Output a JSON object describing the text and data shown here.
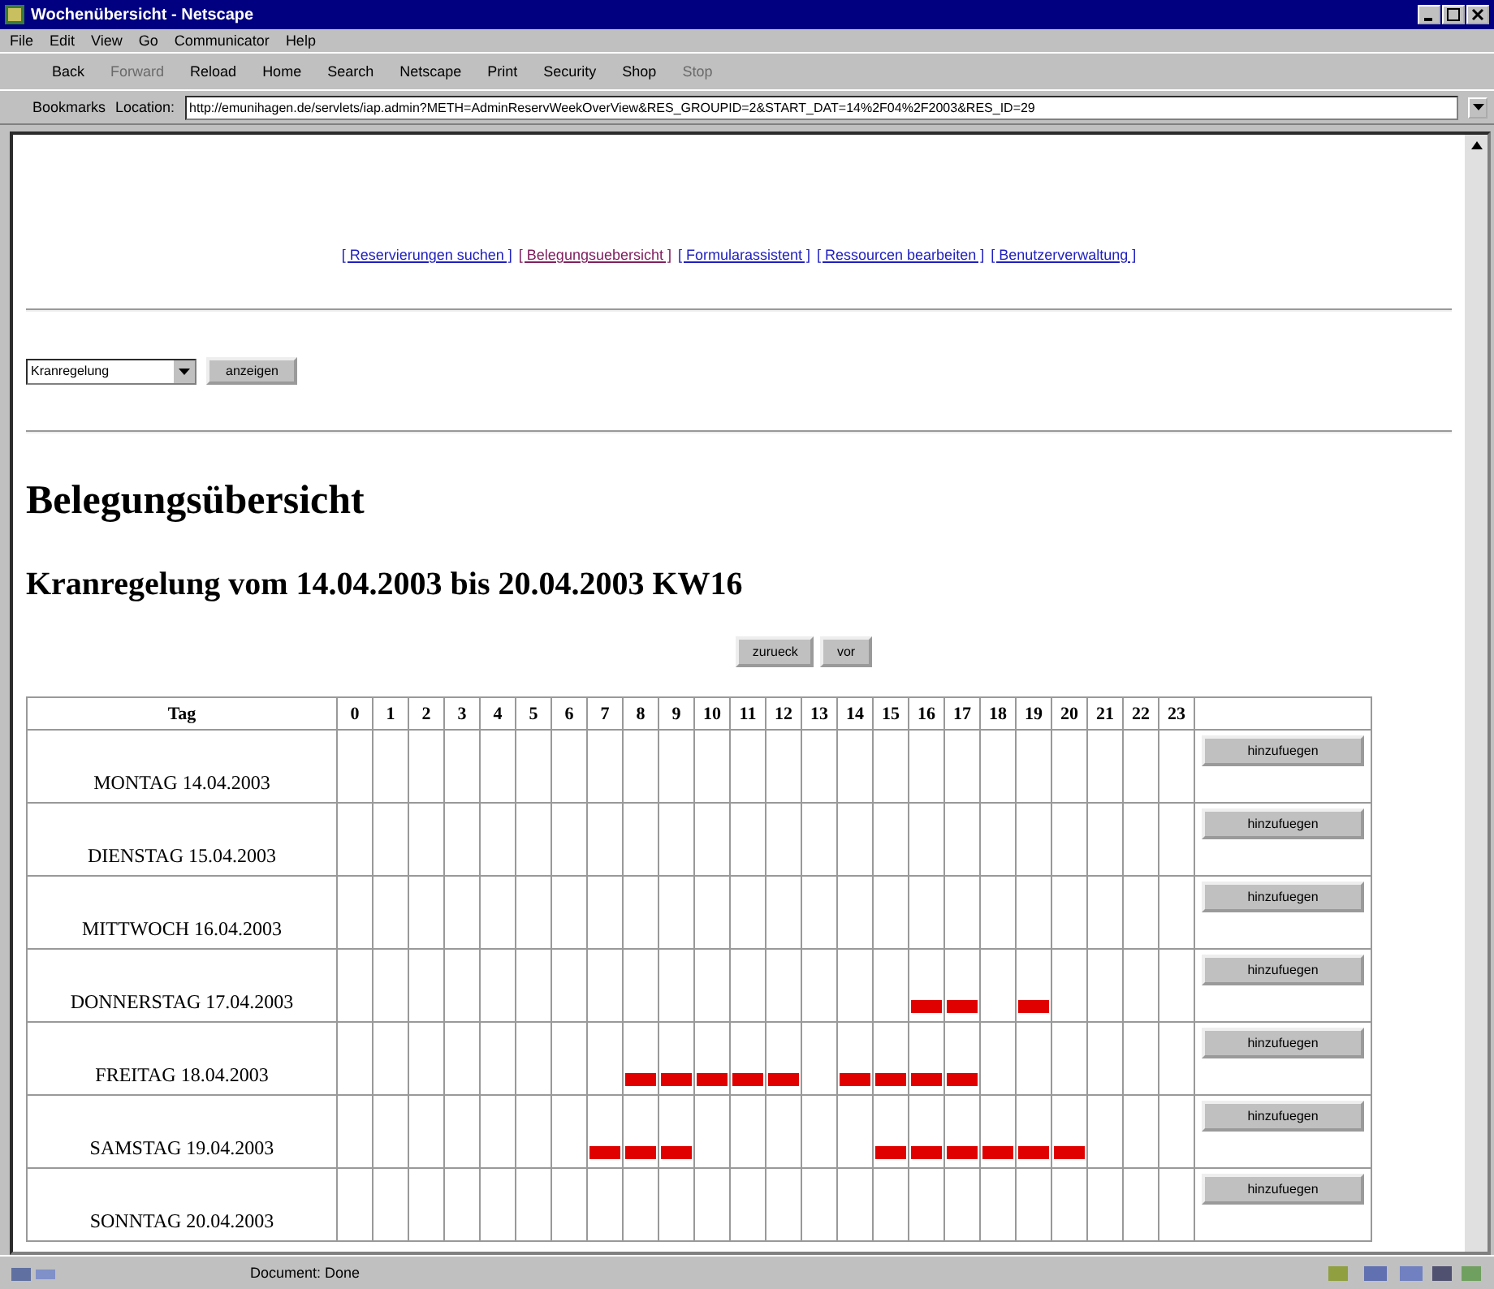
{
  "window": {
    "title": "Wochenübersicht - Netscape"
  },
  "menu": [
    "File",
    "Edit",
    "View",
    "Go",
    "Communicator",
    "Help"
  ],
  "toolbar": [
    {
      "label": "Back",
      "disabled": false
    },
    {
      "label": "Forward",
      "disabled": true
    },
    {
      "label": "Reload",
      "disabled": false
    },
    {
      "label": "Home",
      "disabled": false
    },
    {
      "label": "Search",
      "disabled": false
    },
    {
      "label": "Netscape",
      "disabled": false
    },
    {
      "label": "Print",
      "disabled": false
    },
    {
      "label": "Security",
      "disabled": false
    },
    {
      "label": "Shop",
      "disabled": false
    },
    {
      "label": "Stop",
      "disabled": true
    }
  ],
  "location_bar": {
    "bookmarks": "Bookmarks",
    "label": "Location:",
    "url": "http://emunihagen.de/servlets/iap.admin?METH=AdminReservWeekOverView&RES_GROUPID=2&START_DAT=14%2F04%2F2003&RES_ID=29"
  },
  "nav_links": [
    {
      "label": "[ Reservierungen suchen ]",
      "visited": false
    },
    {
      "label": "[ Belegungsuebersicht ]",
      "visited": true
    },
    {
      "label": "[ Formularassistent ]",
      "visited": false
    },
    {
      "label": "[ Ressourcen bearbeiten ]",
      "visited": false
    },
    {
      "label": "[ Benutzerverwaltung ]",
      "visited": false
    }
  ],
  "resource_select": {
    "value": "Kranregelung"
  },
  "show_button": "anzeigen",
  "heading": "Belegungsübersicht",
  "subheading": "Kranregelung vom 14.04.2003 bis 20.04.2003 KW16",
  "week_buttons": [
    "zurueck",
    "vor"
  ],
  "table": {
    "day_header": "Tag",
    "hours": [
      "0",
      "1",
      "2",
      "3",
      "4",
      "5",
      "6",
      "7",
      "8",
      "9",
      "10",
      "11",
      "12",
      "13",
      "14",
      "15",
      "16",
      "17",
      "18",
      "19",
      "20",
      "21",
      "22",
      "23"
    ],
    "rows": [
      {
        "day": "MONTAG 14.04.2003",
        "button": "hinzufuegen",
        "booked": [
          false,
          false,
          false,
          false,
          false,
          false,
          false,
          false,
          false,
          false,
          false,
          false,
          false,
          false,
          false,
          false,
          false,
          false,
          false,
          false,
          false,
          false,
          false,
          false
        ]
      },
      {
        "day": "DIENSTAG 15.04.2003",
        "button": "hinzufuegen",
        "booked": [
          false,
          false,
          false,
          false,
          false,
          false,
          false,
          false,
          false,
          false,
          false,
          false,
          false,
          false,
          false,
          false,
          false,
          false,
          false,
          false,
          false,
          false,
          false,
          false
        ]
      },
      {
        "day": "MITTWOCH 16.04.2003",
        "button": "hinzufuegen",
        "booked": [
          false,
          false,
          false,
          false,
          false,
          false,
          false,
          false,
          false,
          false,
          false,
          false,
          false,
          false,
          false,
          false,
          false,
          false,
          false,
          false,
          false,
          false,
          false,
          false
        ]
      },
      {
        "day": "DONNERSTAG 17.04.2003",
        "button": "hinzufuegen",
        "booked": [
          false,
          false,
          false,
          false,
          false,
          false,
          false,
          false,
          false,
          false,
          false,
          false,
          false,
          false,
          false,
          false,
          true,
          true,
          false,
          true,
          false,
          false,
          false,
          false
        ]
      },
      {
        "day": "FREITAG 18.04.2003",
        "button": "hinzufuegen",
        "booked": [
          false,
          false,
          false,
          false,
          false,
          false,
          false,
          false,
          true,
          true,
          true,
          true,
          true,
          false,
          true,
          true,
          true,
          true,
          false,
          false,
          false,
          false,
          false,
          false
        ]
      },
      {
        "day": "SAMSTAG 19.04.2003",
        "button": "hinzufuegen",
        "booked": [
          false,
          false,
          false,
          false,
          false,
          false,
          false,
          true,
          true,
          true,
          false,
          false,
          false,
          false,
          false,
          true,
          true,
          true,
          true,
          true,
          true,
          false,
          false,
          false
        ]
      },
      {
        "day": "SONNTAG 20.04.2003",
        "button": "hinzufuegen",
        "booked": [
          false,
          false,
          false,
          false,
          false,
          false,
          false,
          false,
          false,
          false,
          false,
          false,
          false,
          false,
          false,
          false,
          false,
          false,
          false,
          false,
          false,
          false,
          false,
          false
        ]
      }
    ]
  },
  "status_bar": {
    "text": "Document: Done"
  }
}
